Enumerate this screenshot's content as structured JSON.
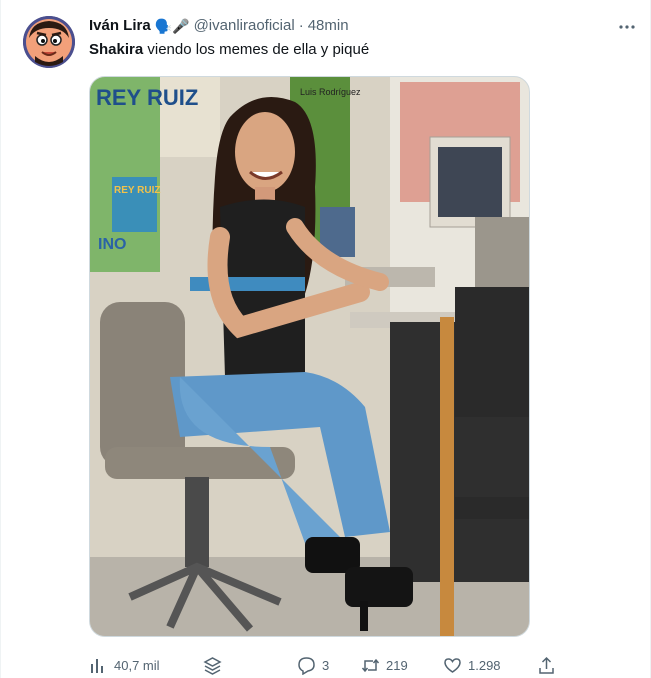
{
  "author": {
    "display_name": "Iván Lira",
    "emojis": "🗣️🎤",
    "handle": "@ivanliraoficial",
    "separator": "·",
    "time": "48min"
  },
  "tweet": {
    "bold_text": "Shakira",
    "text": " viendo los memes de ella y piqué"
  },
  "media": {
    "poster_text_1": "REY RUIZ",
    "poster_text_2": "Luis Rodríguez",
    "poster_text_3": "REY RUIZ",
    "poster_text_4": "INO"
  },
  "actions": {
    "views": "40,7 mil",
    "replies": "3",
    "retweets": "219",
    "likes": "1.298"
  },
  "icons": {
    "more": "more-icon",
    "views": "views-icon",
    "stack": "stack-icon",
    "reply": "reply-icon",
    "retweet": "retweet-icon",
    "like": "heart-icon",
    "share": "share-icon"
  },
  "colors": {
    "text": "#0f1419",
    "muted": "#536471",
    "border": "#cfd9de"
  }
}
